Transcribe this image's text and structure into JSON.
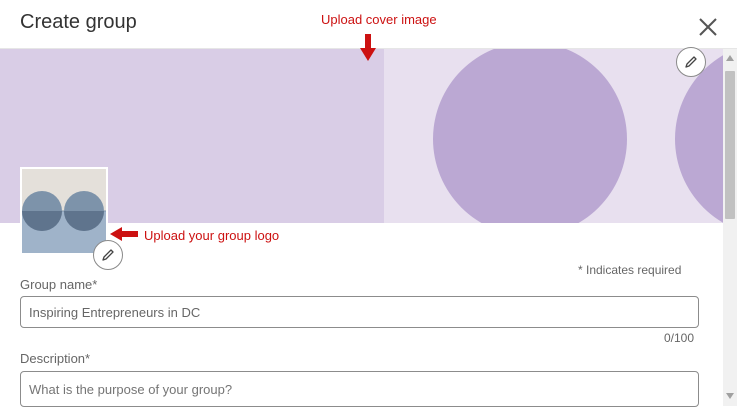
{
  "modal": {
    "title": "Create group"
  },
  "annotations": {
    "cover": "Upload cover image",
    "logo": "Upload your group logo"
  },
  "form": {
    "required_note": "* Indicates required",
    "group_name": {
      "label": "Group name*",
      "value": "Inspiring Entrepreneurs in DC",
      "counter": "0/100"
    },
    "description": {
      "label": "Description*",
      "placeholder": "What is the purpose of your group?"
    }
  },
  "colors": {
    "annotation": "#cc1111",
    "cover_left": "#d9cde6",
    "cover_right": "#e8e0ef",
    "cover_circles": "#bba8d3"
  }
}
